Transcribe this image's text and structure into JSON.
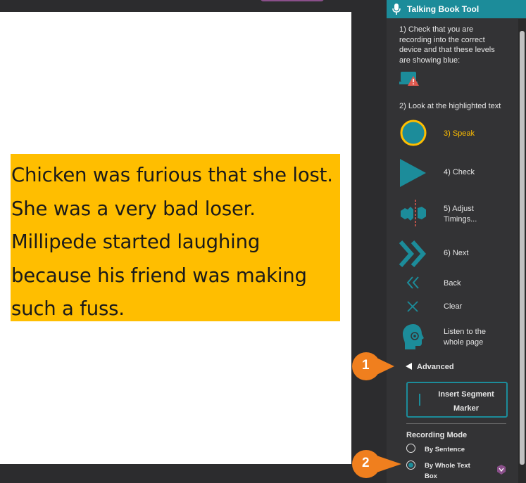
{
  "passage": "Chicken was furious that she lost. She was a very bad loser. Millipede started laughing because his friend was making such a fuss.",
  "panel": {
    "title": "Talking Book Tool",
    "step1": "1) Check that you are recording into the correct device and that these levels are showing blue:",
    "step2": "2) Look at the highlighted text",
    "speak": "3) Speak",
    "check": "4) Check",
    "adjust": "5) Adjust Timings...",
    "next": "6) Next",
    "back": "Back",
    "clear": "Clear",
    "listen": "Listen to the whole page",
    "advanced": "Advanced",
    "insert_segment": "Insert Segment Marker",
    "recording_mode": "Recording Mode",
    "by_sentence": "By Sentence",
    "by_whole_text_box": "By Whole Text Box"
  },
  "callouts": [
    "1",
    "2"
  ],
  "colors": {
    "accent": "#1c8c9a",
    "highlight": "#ffbe00",
    "callout": "#f07f1e"
  }
}
